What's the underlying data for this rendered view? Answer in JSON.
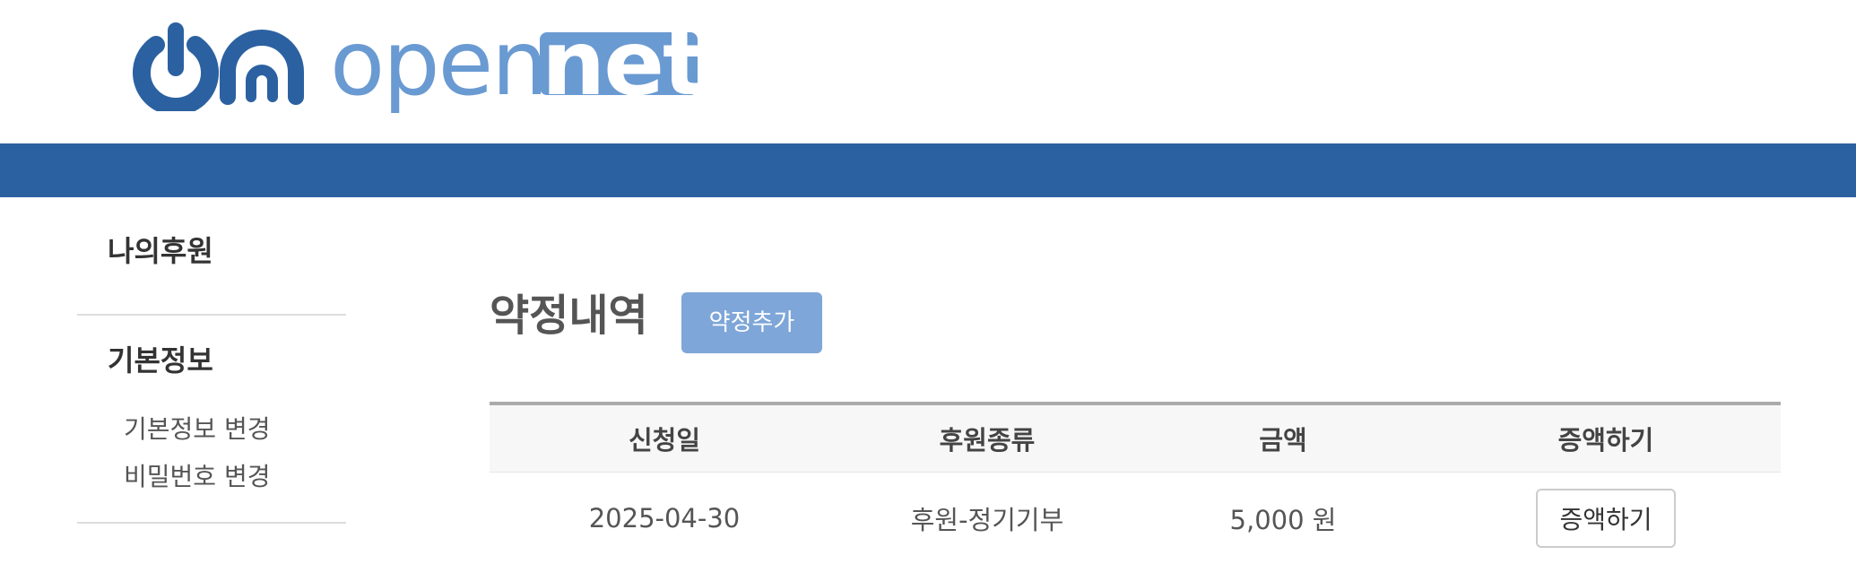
{
  "logo": {
    "text_open": "open",
    "text_net": "net",
    "color": "#6a9ad2",
    "dark_color": "#2c61a1"
  },
  "colors": {
    "nav_bar": "#2c61a1",
    "accent_button": "#7ea6d8"
  },
  "sidebar": {
    "sections": [
      {
        "label": "나의후원"
      },
      {
        "label": "기본정보",
        "items": [
          {
            "label": "기본정보 변경"
          },
          {
            "label": "비밀번호 변경"
          }
        ]
      }
    ]
  },
  "main": {
    "title": "약정내역",
    "add_button": "약정추가",
    "table": {
      "headers": [
        "신청일",
        "후원종류",
        "금액",
        "증액하기"
      ],
      "rows": [
        {
          "date": "2025-04-30",
          "type": "후원-정기기부",
          "amount": "5,000 원",
          "action": "증액하기"
        }
      ]
    }
  }
}
